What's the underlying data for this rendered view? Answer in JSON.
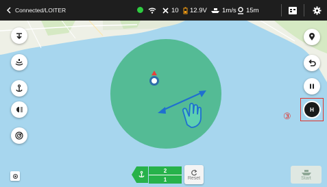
{
  "topbar": {
    "status": "Connected/LOITER",
    "connection_color": "#2ecc40",
    "satellites": "10",
    "voltage": "12.9V",
    "speed": "1m/s",
    "distance": "15m"
  },
  "controls": {
    "circle_counter_top": "2",
    "circle_counter_bottom": "1",
    "reset_label": "Reset",
    "start_label": "Start",
    "hold_label": "H"
  },
  "annotation": {
    "callout_number": "③"
  },
  "icons": {
    "left_toolbar": [
      "waypoint-download-icon",
      "sonar-icon",
      "anchor-icon",
      "light-icon",
      "radar-icon"
    ],
    "right_toolbar": [
      "location-pin-icon",
      "return-icon",
      "pause-icon",
      "hold-icon"
    ]
  },
  "colors": {
    "map_water": "#a7d6ee",
    "loiter_zone": "#4fb98f",
    "accent_green": "#27b24a",
    "highlight_red": "#e0322b"
  }
}
